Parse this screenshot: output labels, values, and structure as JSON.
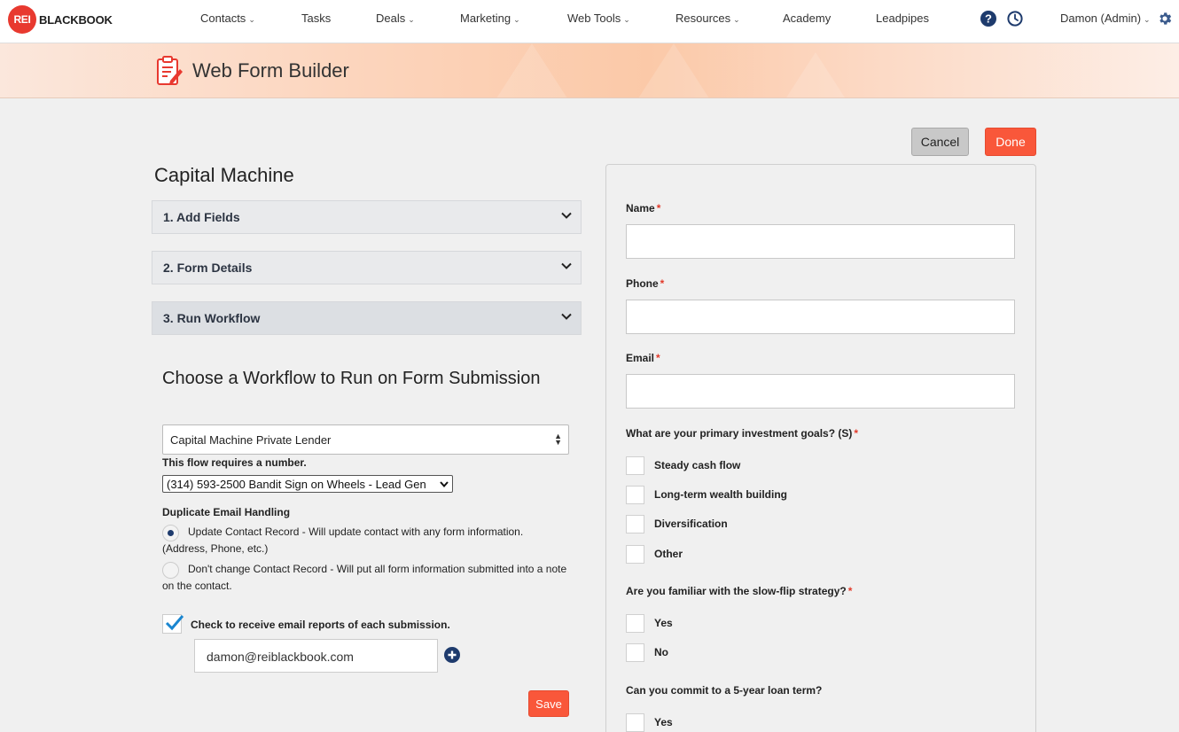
{
  "brand": {
    "badge": "REI",
    "name": "BLACKBOOK"
  },
  "nav": {
    "contacts": "Contacts",
    "tasks": "Tasks",
    "deals": "Deals",
    "marketing": "Marketing",
    "web_tools": "Web Tools",
    "resources": "Resources",
    "academy": "Academy",
    "leadpipes": "Leadpipes",
    "user": "Damon (Admin)"
  },
  "header": {
    "title": "Web Form Builder"
  },
  "actions": {
    "cancel": "Cancel",
    "done": "Done"
  },
  "builder": {
    "form_name": "Capital Machine",
    "sections": [
      {
        "label": "1. Add Fields"
      },
      {
        "label": "2. Form Details"
      },
      {
        "label": "3. Run Workflow"
      }
    ],
    "workflow": {
      "title": "Choose a Workflow to Run on Form Submission",
      "selected": "Capital Machine Private Lender",
      "requires_number": "This flow requires a number.",
      "phone_selected": "(314) 593-2500 Bandit Sign on Wheels - Lead Gen",
      "duplicate_title": "Duplicate Email Handling",
      "option_update": "Update Contact Record - Will update contact with any form information. (Address, Phone, etc.)",
      "option_nochange": "Don't change Contact Record - Will put all form information submitted into a note on the contact.",
      "email_reports_label": "Check to receive email reports of each submission.",
      "email_value": "damon@reiblackbook.com",
      "save": "Save"
    }
  },
  "preview": {
    "name_label": "Name",
    "phone_label": "Phone",
    "email_label": "Email",
    "required_mark": "*",
    "q1": "What are your primary investment goals? (S)",
    "q1_options": [
      "Steady cash flow",
      "Long-term wealth building",
      "Diversification",
      "Other"
    ],
    "q2": "Are you familiar with the slow-flip strategy?",
    "q2_options": [
      "Yes",
      "No"
    ],
    "q3": "Can you commit to a 5-year loan term?",
    "q3_options": [
      "Yes"
    ]
  },
  "colors": {
    "accent": "#f9573a",
    "brand_red": "#e8392f",
    "navy": "#1e3b6d"
  }
}
